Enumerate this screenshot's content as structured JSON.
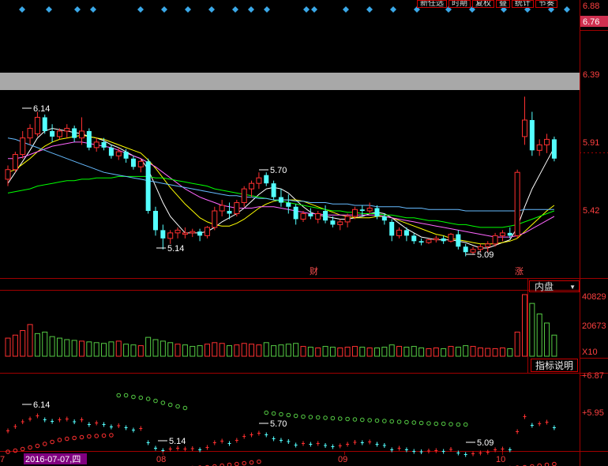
{
  "toolbar": {
    "buttons": [
      "新任选",
      "时期",
      "复权",
      "叠",
      "统计",
      "节奏"
    ]
  },
  "main_price_axis": [
    "6.88",
    "6.76",
    "6.39",
    "5.91",
    "5.42"
  ],
  "main_price_ticks_values": [
    6.88,
    6.76,
    6.39,
    5.91,
    5.42
  ],
  "annotations": {
    "high_1": "6.14",
    "high_2": "5.70",
    "low_1": "5.14",
    "low_2": "5.09",
    "event_1": "财",
    "event_2": "涨"
  },
  "volume_panel": {
    "dropdown": "内盘",
    "axis": [
      "40829",
      "20673",
      "X10"
    ],
    "button": "指标说明"
  },
  "indicator_panel": {
    "axis": [
      "+6.87",
      "+5.95"
    ],
    "labels": [
      "6.14",
      "5.70",
      "5.14",
      "5.09"
    ]
  },
  "date_axis": {
    "labels": [
      "7",
      "2016-07-07,四",
      "08",
      "09",
      "10"
    ],
    "highlight_color": "#800080"
  },
  "colors": {
    "up": "#ff3030",
    "down": "#54ffff",
    "vol_up": "#ff3030",
    "vol_down": "#55cc44",
    "ma5": "#ffffff",
    "ma10": "#ffff00",
    "ma20": "#ff66ff",
    "ma30": "#00ff00",
    "ma60": "#66bbff",
    "grid": "#a00000"
  },
  "chart_data": {
    "type": "candlestick",
    "ylim": [
      5.0,
      6.88
    ],
    "candles": [
      [
        5.65,
        5.75,
        5.6,
        5.72
      ],
      [
        5.72,
        5.85,
        5.7,
        5.83
      ],
      [
        5.83,
        6.0,
        5.8,
        5.95
      ],
      [
        5.95,
        6.05,
        5.9,
        6.02
      ],
      [
        5.98,
        6.14,
        5.96,
        6.1
      ],
      [
        6.1,
        6.12,
        5.98,
        6.0
      ],
      [
        6.0,
        6.05,
        5.92,
        5.96
      ],
      [
        5.96,
        6.02,
        5.94,
        6.0
      ],
      [
        6.0,
        6.05,
        5.95,
        6.02
      ],
      [
        6.02,
        6.04,
        5.92,
        5.95
      ],
      [
        5.95,
        6.1,
        5.9,
        6.0
      ],
      [
        6.0,
        6.02,
        5.86,
        5.88
      ],
      [
        5.88,
        5.95,
        5.85,
        5.92
      ],
      [
        5.92,
        5.95,
        5.86,
        5.88
      ],
      [
        5.88,
        5.9,
        5.8,
        5.82
      ],
      [
        5.82,
        5.88,
        5.79,
        5.85
      ],
      [
        5.85,
        5.87,
        5.77,
        5.8
      ],
      [
        5.8,
        5.82,
        5.72,
        5.74
      ],
      [
        5.74,
        5.8,
        5.7,
        5.78
      ],
      [
        5.78,
        5.8,
        5.4,
        5.42
      ],
      [
        5.42,
        5.45,
        5.24,
        5.28
      ],
      [
        5.28,
        5.32,
        5.14,
        5.22
      ],
      [
        5.22,
        5.28,
        5.18,
        5.26
      ],
      [
        5.26,
        5.3,
        5.22,
        5.28
      ],
      [
        5.25,
        5.3,
        5.22,
        5.26
      ],
      [
        5.26,
        5.29,
        5.23,
        5.27
      ],
      [
        5.27,
        5.29,
        5.2,
        5.24
      ],
      [
        5.24,
        5.31,
        5.22,
        5.3
      ],
      [
        5.3,
        5.45,
        5.28,
        5.42
      ],
      [
        5.42,
        5.5,
        5.38,
        5.46
      ],
      [
        5.42,
        5.48,
        5.36,
        5.4
      ],
      [
        5.4,
        5.5,
        5.38,
        5.48
      ],
      [
        5.48,
        5.6,
        5.45,
        5.58
      ],
      [
        5.58,
        5.64,
        5.52,
        5.62
      ],
      [
        5.62,
        5.7,
        5.58,
        5.66
      ],
      [
        5.68,
        5.7,
        5.6,
        5.62
      ],
      [
        5.62,
        5.64,
        5.5,
        5.52
      ],
      [
        5.52,
        5.58,
        5.45,
        5.48
      ],
      [
        5.48,
        5.54,
        5.4,
        5.45
      ],
      [
        5.45,
        5.47,
        5.32,
        5.36
      ],
      [
        5.36,
        5.42,
        5.34,
        5.4
      ],
      [
        5.4,
        5.44,
        5.36,
        5.38
      ],
      [
        5.36,
        5.42,
        5.33,
        5.4
      ],
      [
        5.42,
        5.46,
        5.33,
        5.35
      ],
      [
        5.35,
        5.38,
        5.3,
        5.32
      ],
      [
        5.32,
        5.36,
        5.28,
        5.34
      ],
      [
        5.34,
        5.4,
        5.3,
        5.38
      ],
      [
        5.38,
        5.45,
        5.36,
        5.43
      ],
      [
        5.43,
        5.46,
        5.38,
        5.42
      ],
      [
        5.42,
        5.48,
        5.4,
        5.44
      ],
      [
        5.44,
        5.46,
        5.36,
        5.38
      ],
      [
        5.38,
        5.4,
        5.32,
        5.35
      ],
      [
        5.34,
        5.36,
        5.2,
        5.24
      ],
      [
        5.24,
        5.3,
        5.22,
        5.28
      ],
      [
        5.28,
        5.3,
        5.2,
        5.24
      ],
      [
        5.24,
        5.26,
        5.18,
        5.2
      ],
      [
        5.2,
        5.22,
        5.17,
        5.19
      ],
      [
        5.19,
        5.22,
        5.18,
        5.21
      ],
      [
        5.21,
        5.24,
        5.19,
        5.22
      ],
      [
        5.22,
        5.24,
        5.18,
        5.2
      ],
      [
        5.2,
        5.26,
        5.19,
        5.25
      ],
      [
        5.25,
        5.28,
        5.14,
        5.16
      ],
      [
        5.16,
        5.18,
        5.09,
        5.12
      ],
      [
        5.12,
        5.16,
        5.1,
        5.14
      ],
      [
        5.14,
        5.18,
        5.12,
        5.16
      ],
      [
        5.16,
        5.2,
        5.12,
        5.18
      ],
      [
        5.18,
        5.26,
        5.16,
        5.24
      ],
      [
        5.24,
        5.28,
        5.2,
        5.26
      ],
      [
        5.26,
        5.3,
        5.22,
        5.24
      ],
      [
        5.24,
        5.72,
        5.22,
        5.7
      ],
      [
        5.96,
        6.25,
        5.9,
        6.08
      ],
      [
        6.08,
        6.14,
        5.82,
        5.86
      ],
      [
        5.86,
        5.94,
        5.82,
        5.9
      ],
      [
        5.9,
        5.98,
        5.84,
        5.94
      ],
      [
        5.94,
        5.96,
        5.78,
        5.8
      ]
    ],
    "volumes": [
      [
        1,
        12000
      ],
      [
        1,
        14000
      ],
      [
        1,
        17000
      ],
      [
        1,
        21000
      ],
      [
        0,
        15000
      ],
      [
        0,
        16000
      ],
      [
        0,
        13000
      ],
      [
        0,
        12000
      ],
      [
        0,
        11000
      ],
      [
        0,
        10500
      ],
      [
        1,
        10000
      ],
      [
        0,
        9500
      ],
      [
        0,
        9000
      ],
      [
        0,
        8500
      ],
      [
        0,
        9500
      ],
      [
        1,
        10000
      ],
      [
        0,
        8000
      ],
      [
        0,
        7500
      ],
      [
        1,
        7000
      ],
      [
        0,
        12500
      ],
      [
        0,
        11000
      ],
      [
        0,
        10000
      ],
      [
        0,
        9000
      ],
      [
        1,
        8000
      ],
      [
        0,
        7500
      ],
      [
        0,
        6500
      ],
      [
        0,
        7000
      ],
      [
        1,
        8000
      ],
      [
        1,
        9000
      ],
      [
        1,
        8500
      ],
      [
        0,
        7000
      ],
      [
        1,
        7500
      ],
      [
        1,
        8500
      ],
      [
        1,
        8000
      ],
      [
        1,
        7500
      ],
      [
        0,
        9000
      ],
      [
        0,
        7000
      ],
      [
        0,
        7500
      ],
      [
        0,
        8000
      ],
      [
        0,
        8500
      ],
      [
        1,
        6500
      ],
      [
        0,
        6000
      ],
      [
        1,
        5500
      ],
      [
        0,
        6500
      ],
      [
        0,
        6000
      ],
      [
        1,
        5500
      ],
      [
        1,
        6000
      ],
      [
        1,
        6500
      ],
      [
        0,
        6000
      ],
      [
        1,
        5500
      ],
      [
        0,
        5500
      ],
      [
        0,
        6000
      ],
      [
        0,
        7500
      ],
      [
        1,
        6500
      ],
      [
        0,
        6000
      ],
      [
        0,
        6500
      ],
      [
        0,
        5500
      ],
      [
        1,
        5000
      ],
      [
        1,
        5500
      ],
      [
        0,
        5000
      ],
      [
        1,
        6500
      ],
      [
        0,
        6000
      ],
      [
        0,
        7000
      ],
      [
        1,
        6500
      ],
      [
        1,
        5500
      ],
      [
        1,
        5200
      ],
      [
        1,
        5000
      ],
      [
        1,
        5500
      ],
      [
        0,
        5000
      ],
      [
        1,
        16000
      ],
      [
        1,
        40829
      ],
      [
        0,
        35000
      ],
      [
        0,
        28000
      ],
      [
        0,
        22000
      ],
      [
        0,
        14000
      ]
    ],
    "overlays": {
      "ma5": [
        5.62,
        5.7,
        5.78,
        5.86,
        5.95,
        6.0,
        6.02,
        6.01,
        6.0,
        5.99,
        5.98,
        5.96,
        5.95,
        5.93,
        5.9,
        5.88,
        5.85,
        5.82,
        5.8,
        5.72,
        5.6,
        5.48,
        5.38,
        5.32,
        5.26,
        5.26,
        5.26,
        5.27,
        5.3,
        5.34,
        5.37,
        5.4,
        5.44,
        5.49,
        5.54,
        5.58,
        5.59,
        5.58,
        5.55,
        5.5,
        5.45,
        5.41,
        5.39,
        5.38,
        5.37,
        5.36,
        5.36,
        5.37,
        5.38,
        5.4,
        5.41,
        5.4,
        5.37,
        5.33,
        5.29,
        5.26,
        5.23,
        5.22,
        5.21,
        5.21,
        5.21,
        5.2,
        5.19,
        5.17,
        5.15,
        5.15,
        5.17,
        5.19,
        5.21,
        5.3,
        5.45,
        5.58,
        5.68,
        5.78,
        5.88
      ],
      "ma10": [
        5.7,
        5.72,
        5.76,
        5.8,
        5.85,
        5.89,
        5.92,
        5.94,
        5.95,
        5.96,
        5.97,
        5.96,
        5.95,
        5.94,
        5.92,
        5.9,
        5.88,
        5.86,
        5.84,
        5.79,
        5.73,
        5.66,
        5.59,
        5.53,
        5.47,
        5.42,
        5.37,
        5.34,
        5.32,
        5.31,
        5.31,
        5.33,
        5.36,
        5.4,
        5.44,
        5.47,
        5.49,
        5.5,
        5.5,
        5.5,
        5.49,
        5.47,
        5.45,
        5.43,
        5.41,
        5.39,
        5.38,
        5.37,
        5.37,
        5.37,
        5.38,
        5.38,
        5.37,
        5.35,
        5.33,
        5.31,
        5.29,
        5.27,
        5.25,
        5.24,
        5.22,
        5.21,
        5.2,
        5.19,
        5.18,
        5.18,
        5.18,
        5.19,
        5.2,
        5.22,
        5.27,
        5.32,
        5.37,
        5.42,
        5.46
      ],
      "ma20": [
        5.8,
        5.8,
        5.81,
        5.83,
        5.85,
        5.87,
        5.89,
        5.9,
        5.91,
        5.92,
        5.92,
        5.91,
        5.9,
        5.89,
        5.88,
        5.86,
        5.84,
        5.82,
        5.8,
        5.77,
        5.74,
        5.7,
        5.66,
        5.62,
        5.58,
        5.55,
        5.52,
        5.5,
        5.48,
        5.46,
        5.45,
        5.44,
        5.44,
        5.44,
        5.45,
        5.45,
        5.45,
        5.44,
        5.43,
        5.42,
        5.41,
        5.4,
        5.4,
        5.39,
        5.39,
        5.39,
        5.39,
        5.39,
        5.39,
        5.39,
        5.39,
        5.38,
        5.37,
        5.36,
        5.35,
        5.34,
        5.33,
        5.32,
        5.31,
        5.3,
        5.29,
        5.28,
        5.27,
        5.26,
        5.25,
        5.24,
        5.23,
        5.23,
        5.23,
        5.24,
        5.26,
        5.29,
        5.32,
        5.35,
        5.38
      ],
      "ma30": [
        5.55,
        5.56,
        5.57,
        5.58,
        5.6,
        5.61,
        5.62,
        5.63,
        5.64,
        5.64,
        5.65,
        5.65,
        5.66,
        5.66,
        5.66,
        5.67,
        5.67,
        5.67,
        5.67,
        5.67,
        5.66,
        5.66,
        5.65,
        5.64,
        5.63,
        5.62,
        5.61,
        5.6,
        5.58,
        5.57,
        5.56,
        5.55,
        5.54,
        5.53,
        5.52,
        5.51,
        5.5,
        5.49,
        5.48,
        5.47,
        5.46,
        5.45,
        5.44,
        5.43,
        5.42,
        5.42,
        5.41,
        5.41,
        5.4,
        5.4,
        5.4,
        5.39,
        5.39,
        5.38,
        5.37,
        5.37,
        5.36,
        5.35,
        5.35,
        5.34,
        5.33,
        5.32,
        5.32,
        5.31,
        5.3,
        5.3,
        5.3,
        5.3,
        5.31,
        5.32,
        5.34,
        5.36,
        5.38,
        5.4,
        5.42
      ],
      "ma60": [
        5.95,
        5.94,
        5.92,
        5.9,
        5.88,
        5.86,
        5.84,
        5.82,
        5.8,
        5.78,
        5.76,
        5.74,
        5.72,
        5.7,
        5.69,
        5.68,
        5.67,
        5.66,
        5.65,
        5.64,
        5.63,
        5.62,
        5.61,
        5.6,
        5.59,
        5.58,
        5.57,
        5.56,
        5.55,
        5.54,
        5.53,
        5.53,
        5.52,
        5.52,
        5.51,
        5.51,
        5.5,
        5.5,
        5.5,
        5.49,
        5.49,
        5.48,
        5.48,
        5.48,
        5.47,
        5.47,
        5.47,
        5.46,
        5.46,
        5.46,
        5.45,
        5.45,
        5.45,
        5.45,
        5.44,
        5.44,
        5.44,
        5.43,
        5.43,
        5.43,
        5.43,
        5.43,
        5.42,
        5.42,
        5.42,
        5.42,
        5.42,
        5.42,
        5.42,
        5.42,
        5.43,
        5.43,
        5.43,
        5.43,
        5.43
      ]
    },
    "sar": [
      5.55,
      5.58,
      5.62,
      5.66,
      5.7,
      5.75,
      5.8,
      5.85,
      5.88,
      5.9,
      5.92,
      5.94,
      5.95,
      5.96,
      5.97,
      6.14,
      6.14,
      6.1,
      6.08,
      6.05,
      6.0,
      5.95,
      5.9,
      5.86,
      5.82,
      5.14,
      5.15,
      5.16,
      5.18,
      5.2,
      5.22,
      5.24,
      5.26,
      5.28,
      5.3,
      5.7,
      5.68,
      5.66,
      5.64,
      5.62,
      5.6,
      5.59,
      5.58,
      5.57,
      5.56,
      5.55,
      5.54,
      5.53,
      5.52,
      5.51,
      5.5,
      5.49,
      5.48,
      5.47,
      5.46,
      5.45,
      5.44,
      5.43,
      5.42,
      5.42,
      5.41,
      5.4,
      5.4,
      5.09,
      5.1,
      5.11,
      5.12,
      5.13,
      5.14,
      5.15,
      5.16,
      5.18,
      5.2,
      5.22,
      5.24
    ],
    "sar_trend": [
      1,
      1,
      1,
      1,
      1,
      1,
      1,
      1,
      1,
      1,
      1,
      1,
      1,
      1,
      1,
      0,
      0,
      0,
      0,
      0,
      0,
      0,
      0,
      0,
      0,
      1,
      1,
      1,
      1,
      1,
      1,
      1,
      1,
      1,
      1,
      0,
      0,
      0,
      0,
      0,
      0,
      0,
      0,
      0,
      0,
      0,
      0,
      0,
      0,
      0,
      0,
      0,
      0,
      0,
      0,
      0,
      0,
      0,
      0,
      0,
      0,
      0,
      0,
      1,
      1,
      1,
      1,
      1,
      1,
      1,
      1,
      1,
      1,
      1,
      1
    ]
  }
}
